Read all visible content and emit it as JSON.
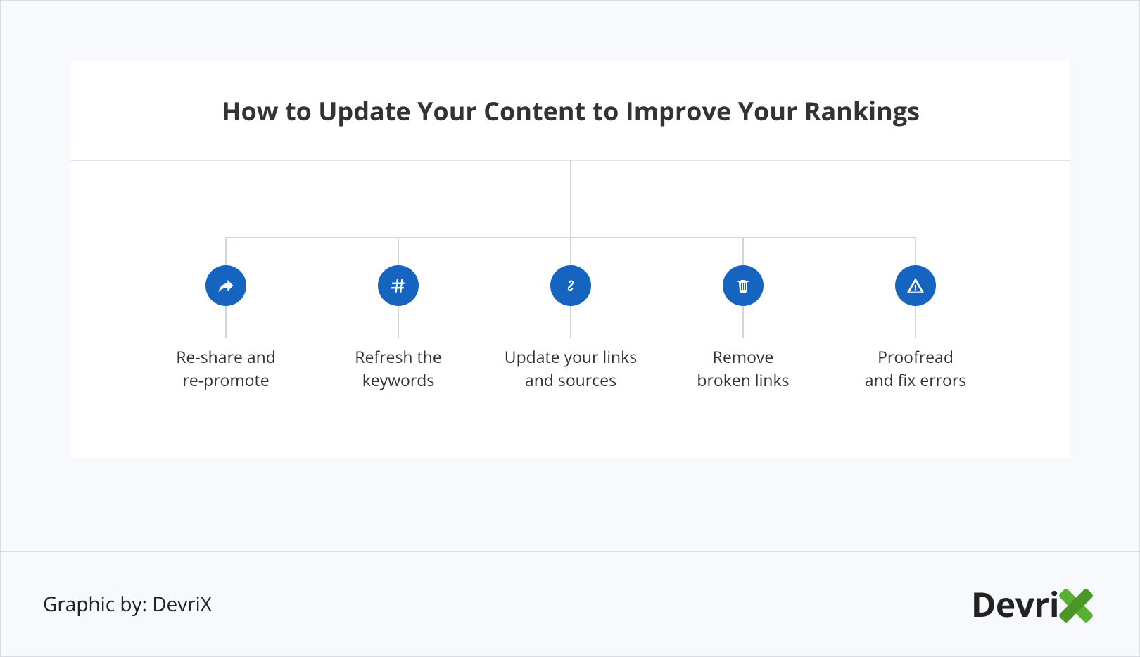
{
  "title": "How to Update Your Content to Improve Your Rankings",
  "items": [
    {
      "icon": "share-icon",
      "label": "Re-share and\nre-promote"
    },
    {
      "icon": "hashtag-icon",
      "label": "Refresh the\nkeywords"
    },
    {
      "icon": "link-icon",
      "label": "Update your links\nand sources"
    },
    {
      "icon": "trash-icon",
      "label": "Remove\nbroken links"
    },
    {
      "icon": "warning-icon",
      "label": "Proofread\nand fix errors"
    }
  ],
  "footer": {
    "credit": "Graphic by: DevriX",
    "brand_prefix": "Devri",
    "brand_accent": "X"
  },
  "colors": {
    "badge": "#1565c0",
    "accent": "#5ab031",
    "line": "#cfd6e2",
    "page_bg": "#f7f9fc"
  }
}
